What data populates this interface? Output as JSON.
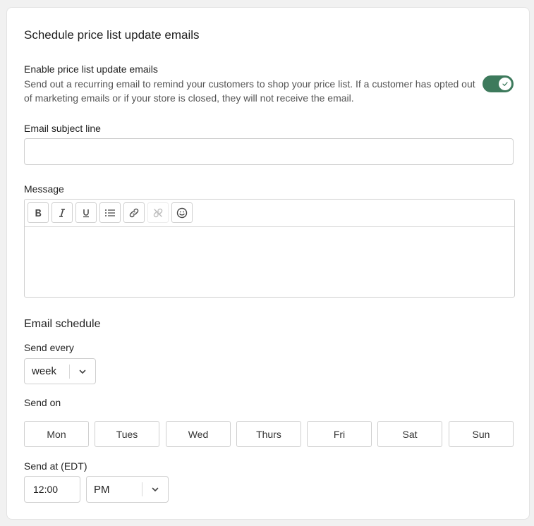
{
  "title": "Schedule price list update emails",
  "enable": {
    "label": "Enable price list update emails",
    "description": "Send out a recurring email to remind your customers to shop your price list. If a customer has opted out of marketing emails or if your store is closed, they will not receive the email.",
    "enabled": true
  },
  "subject": {
    "label": "Email subject line",
    "value": "",
    "placeholder": ""
  },
  "message": {
    "label": "Message",
    "toolbar": [
      "bold-icon",
      "italic-icon",
      "underline-icon",
      "list-icon",
      "link-icon",
      "unlink-icon",
      "emoji-icon"
    ],
    "value": ""
  },
  "schedule": {
    "title": "Email schedule",
    "send_every_label": "Send every",
    "send_every_value": "week",
    "send_on_label": "Send on",
    "days": [
      "Mon",
      "Tues",
      "Wed",
      "Thurs",
      "Fri",
      "Sat",
      "Sun"
    ],
    "send_at_label": "Send at (EDT)",
    "time_value": "12:00",
    "ampm_value": "PM"
  },
  "colors": {
    "toggle_on": "#3d7a5c"
  }
}
